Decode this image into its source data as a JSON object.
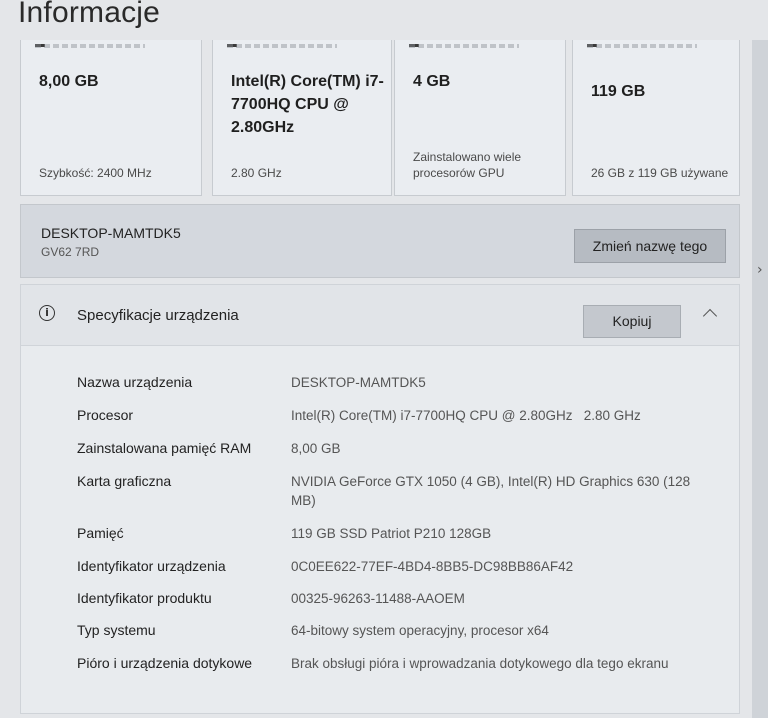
{
  "page_title": "Informacje",
  "cards": [
    {
      "value": "8,00 GB",
      "sub": "Szybkość: 2400 MHz"
    },
    {
      "value": "Intel(R) Core(TM) i7-7700HQ CPU @ 2.80GHz",
      "sub": "2.80 GHz"
    },
    {
      "value": "4 GB",
      "sub": "Zainstalowano wiele procesorów GPU"
    },
    {
      "value": "119 GB",
      "sub": "26 GB z 119 GB używane"
    }
  ],
  "device": {
    "name": "DESKTOP-MAMTDK5",
    "model": "GV62 7RD",
    "rename_label": "Zmień nazwę tego"
  },
  "spec": {
    "title": "Specyfikacje urządzenia",
    "copy_label": "Kopiuj",
    "rows": [
      {
        "label": "Nazwa urządzenia",
        "value": "DESKTOP-MAMTDK5"
      },
      {
        "label": "Procesor",
        "value": "Intel(R) Core(TM) i7-7700HQ CPU @ 2.80GHz   2.80 GHz"
      },
      {
        "label": "Zainstalowana pamięć RAM",
        "value": "8,00 GB"
      },
      {
        "label": "Karta graficzna",
        "value": "NVIDIA GeForce GTX 1050 (4 GB), Intel(R) HD Graphics 630 (128 MB)"
      },
      {
        "label": "Pamięć",
        "value": "119 GB SSD Patriot P210 128GB"
      },
      {
        "label": "Identyfikator urządzenia",
        "value": "0C0EE622-77EF-4BD4-8BB5-DC98BB86AF42"
      },
      {
        "label": "Identyfikator produktu",
        "value": "00325-96263-11488-AAOEM"
      },
      {
        "label": "Typ systemu",
        "value": "64-bitowy system operacyjny, procesor x64"
      },
      {
        "label": "Pióro i urządzenia dotykowe",
        "value": "Brak obsługi pióra i wprowadzania dotykowego dla tego ekranu"
      }
    ]
  }
}
